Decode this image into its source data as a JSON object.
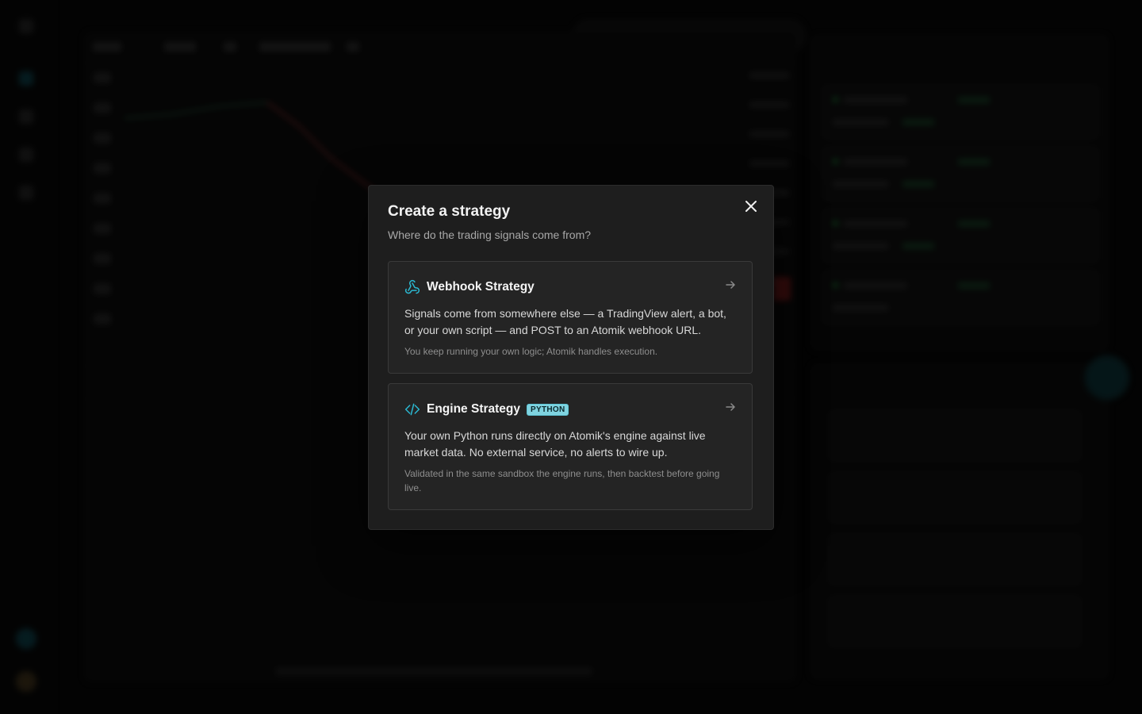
{
  "modal": {
    "title": "Create a strategy",
    "subtitle": "Where do the trading signals come from?",
    "close_icon": "close-icon",
    "options": [
      {
        "title": "Webhook Strategy",
        "icon": "webhook-icon",
        "badge": "",
        "description": "Signals come from somewhere else — a TradingView alert, a bot, or your own script — and POST to an Atomik webhook URL.",
        "note": "You keep running your own logic; Atomik handles execution."
      },
      {
        "title": "Engine Strategy",
        "icon": "code-icon",
        "badge": "PYTHON",
        "description": "Your own Python runs directly on Atomik's engine against live market data. No external service, no alerts to wire up.",
        "note": "Validated in the same sandbox the engine runs, then backtest before going live."
      }
    ]
  },
  "colors": {
    "accent": "#2bb8d1",
    "badge_bg": "#7fd3e0",
    "modal_bg": "#1e1e1e",
    "card_bg": "#242424",
    "page_bg": "#050505"
  }
}
